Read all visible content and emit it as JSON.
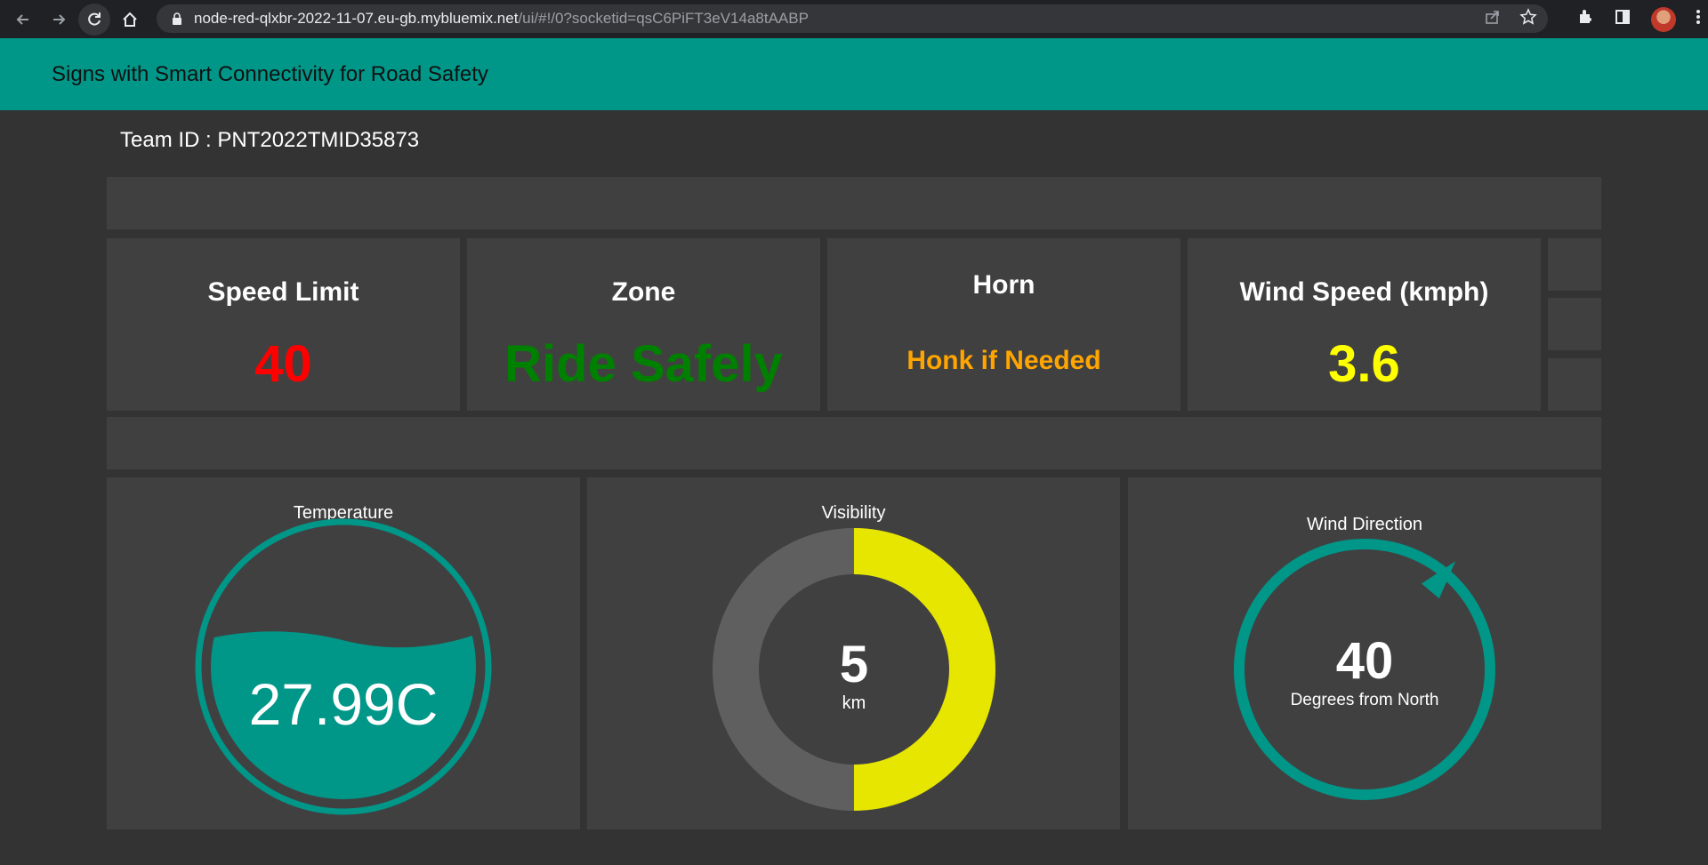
{
  "browser": {
    "url_host": "node-red-qlxbr-2022-11-07.eu-gb.mybluemix.net",
    "url_path": "/ui/#!/0?socketid=qsC6PiFT3eV14a8tAABP"
  },
  "header": {
    "title": "Signs with Smart Connectivity for Road Safety"
  },
  "team": {
    "label": "Team ID : PNT2022TMID35873"
  },
  "cards": {
    "speed": {
      "title": "Speed Limit",
      "value": "40",
      "color": "#ff0000"
    },
    "zone": {
      "title": "Zone",
      "value": "Ride Safely",
      "color": "#008000"
    },
    "horn": {
      "title": "Horn",
      "value": "Honk if Needed",
      "color": "#ffa500"
    },
    "wind_speed": {
      "title": "Wind Speed (kmph)",
      "value": "3.6",
      "color": "#ffff00"
    }
  },
  "gauges": {
    "temperature": {
      "title": "Temperature",
      "value": "27.99C",
      "level": 0.6
    },
    "visibility": {
      "title": "Visibility",
      "value": "5",
      "unit": "km",
      "fraction": 0.5
    },
    "wind_direction": {
      "title": "Wind Direction",
      "value": "40",
      "unit": "Degrees from North",
      "degrees": 40
    }
  },
  "colors": {
    "accent": "#009688",
    "page_bg": "#333333",
    "card_bg": "#404040",
    "visibility_fill": "#e6e600",
    "visibility_track": "#5f5f5f"
  }
}
